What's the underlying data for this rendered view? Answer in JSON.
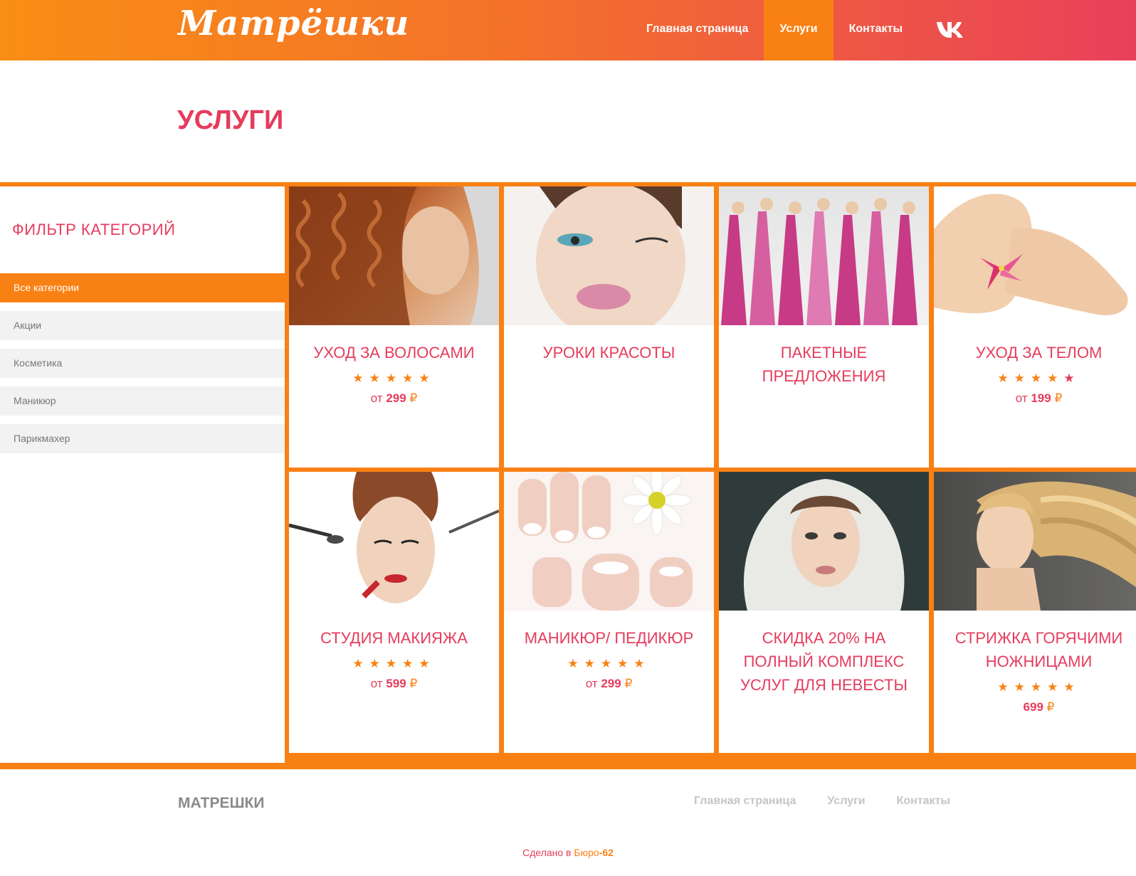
{
  "header": {
    "logo": "Матрёшки",
    "nav": [
      {
        "label": "Главная страница",
        "active": false
      },
      {
        "label": "Услуги",
        "active": true
      },
      {
        "label": "Контакты",
        "active": false
      }
    ],
    "social_icon": "vk-icon"
  },
  "page_title": "УСЛУГИ",
  "sidebar": {
    "title": "ФИЛЬТР КАТЕГОРИЙ",
    "items": [
      {
        "label": "Все категории",
        "active": true
      },
      {
        "label": "Акции",
        "active": false
      },
      {
        "label": "Косметика",
        "active": false
      },
      {
        "label": "Маникюр",
        "active": false
      },
      {
        "label": "Парикмахер",
        "active": false
      }
    ]
  },
  "cards": [
    {
      "title": "Уход за волосами",
      "stars": 5,
      "price_prefix": "от",
      "price": "299",
      "currency": "₽",
      "image": "curly-hair-photo"
    },
    {
      "title": "Уроки красоты",
      "stars": 0,
      "price_prefix": "",
      "price": "",
      "currency": "",
      "image": "makeup-face-photo"
    },
    {
      "title": "Пакетные предложения",
      "stars": 0,
      "price_prefix": "",
      "price": "",
      "currency": "",
      "image": "bridesmaids-photo"
    },
    {
      "title": "Уход за телом",
      "stars": 5,
      "price_prefix": "от",
      "price": "199",
      "currency": "₽",
      "image": "body-lily-photo"
    },
    {
      "title": "Студия макияжа",
      "stars": 5,
      "price_prefix": "от",
      "price": "599",
      "currency": "₽",
      "image": "makeup-brushes-photo"
    },
    {
      "title": "Маникюр/ педикюр",
      "stars": 5,
      "price_prefix": "от",
      "price": "299",
      "currency": "₽",
      "image": "nails-daisy-photo"
    },
    {
      "title": "Скидка 20% на полный комплекс услуг для невесты",
      "stars": 0,
      "price_prefix": "",
      "price": "",
      "currency": "",
      "image": "bride-veil-photo"
    },
    {
      "title": "Стрижка горячими ножницами",
      "stars": 5,
      "price_prefix": "",
      "price": "699",
      "currency": "₽",
      "image": "blonde-hair-photo"
    }
  ],
  "footer": {
    "brand": "МАТРЕШКИ",
    "links": [
      "Главная страница",
      "Услуги",
      "Контакты"
    ],
    "credit_prefix": "Сделано в",
    "credit_link_a": "Бюро",
    "credit_link_b": "-62"
  },
  "colors": {
    "accent": "#f98114",
    "pink": "#e63c5c"
  }
}
